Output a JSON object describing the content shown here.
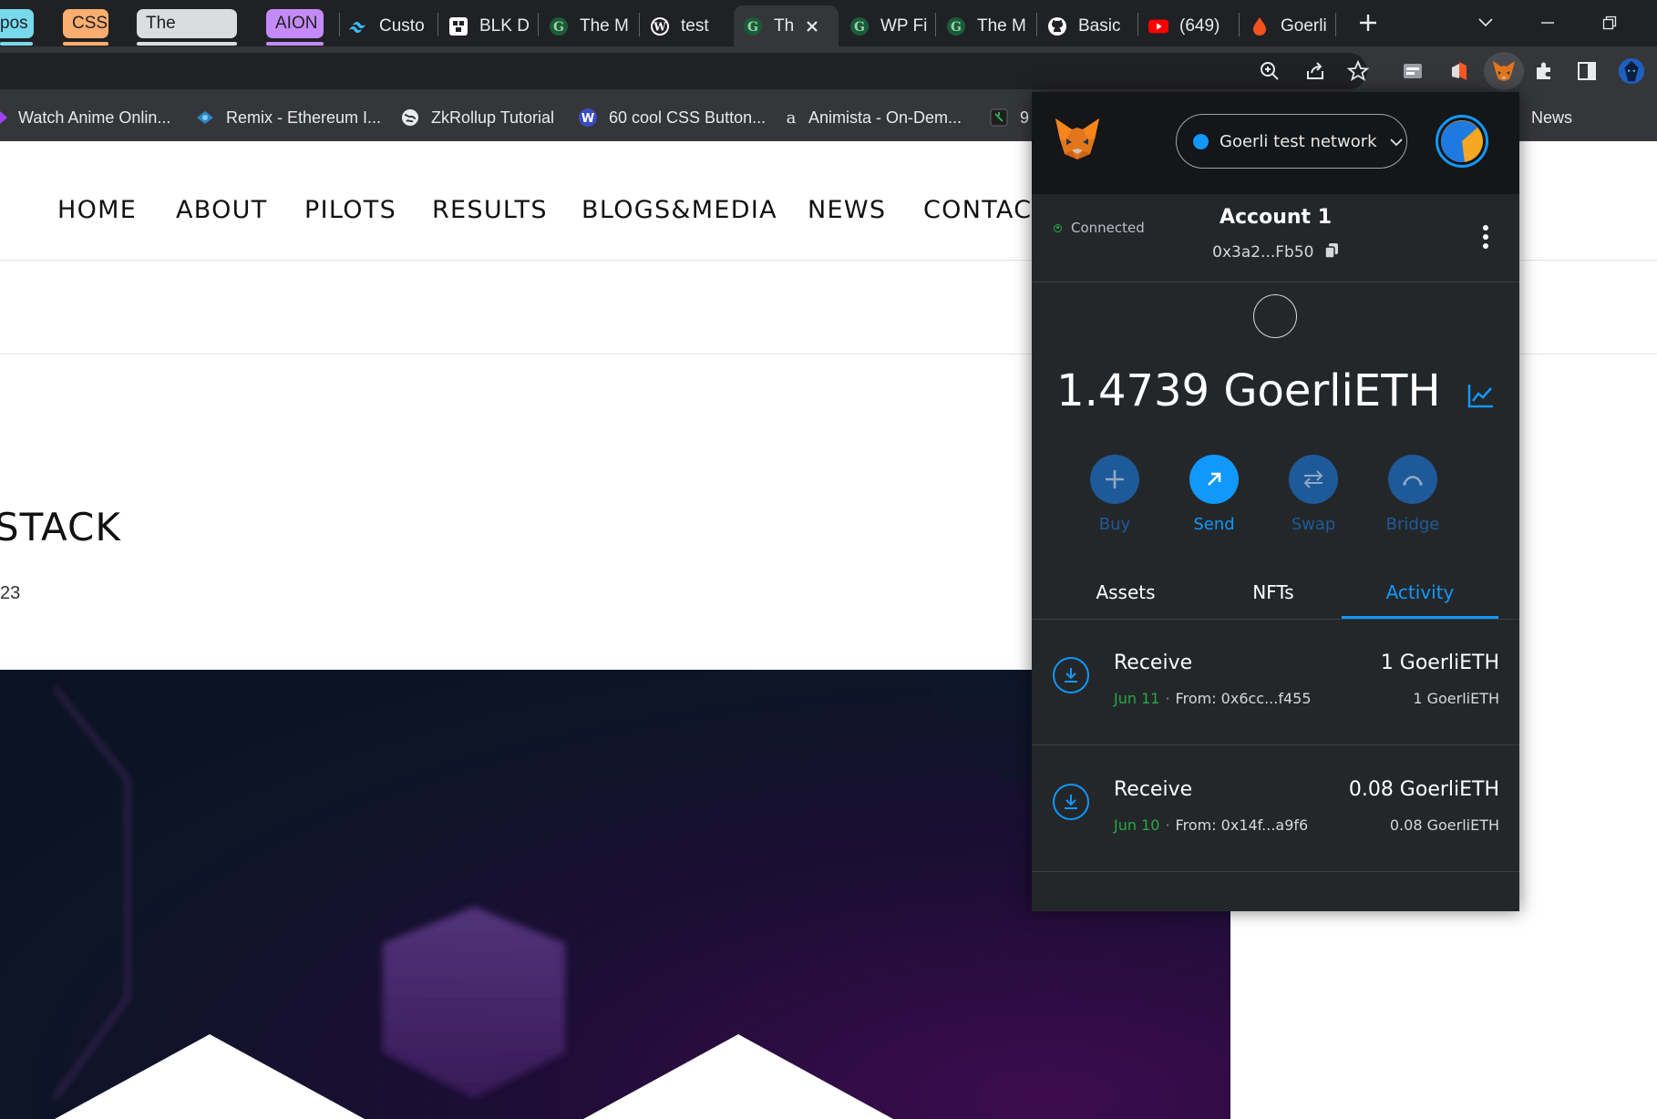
{
  "browser": {
    "tab_groups": [
      {
        "label": "pos",
        "bg": "#78d9ec",
        "color": "#202124"
      },
      {
        "label": "CSS",
        "bg": "#fcad70",
        "color": "#202124"
      },
      {
        "label": "The Others",
        "bg": "#dadce0",
        "color": "#202124"
      },
      {
        "label": "AION",
        "bg": "#c58af9",
        "color": "#202124"
      }
    ],
    "tabs": [
      {
        "title": "Custo",
        "icon": "tailwind-icon"
      },
      {
        "title": "BLK D",
        "icon": "blk-icon"
      },
      {
        "title": "The M",
        "icon": "g-logo-icon"
      },
      {
        "title": "test",
        "icon": "wordpress-icon"
      },
      {
        "title": "Th",
        "icon": "g-logo-icon",
        "active": true
      },
      {
        "title": "WP Fi",
        "icon": "g-logo-icon"
      },
      {
        "title": "The M",
        "icon": "g-logo-icon"
      },
      {
        "title": "Basic",
        "icon": "github-icon"
      },
      {
        "title": "(649)",
        "icon": "youtube-icon"
      },
      {
        "title": "Goerli",
        "icon": "faucet-drop-icon"
      }
    ],
    "bookmarks": [
      {
        "label": "Watch Anime Onlin..."
      },
      {
        "label": "Remix - Ethereum I..."
      },
      {
        "label": "ZkRollup Tutorial"
      },
      {
        "label": "60 cool CSS Button..."
      },
      {
        "label": "Animista - On-Dem..."
      },
      {
        "label": "9"
      },
      {
        "label": "News"
      }
    ]
  },
  "page": {
    "nav": [
      "HOME",
      "ABOUT",
      "PILOTS",
      "RESULTS",
      "BLOGS&MEDIA",
      "NEWS",
      "CONTACT"
    ],
    "post_title": "STACK",
    "post_date": "23"
  },
  "metamask": {
    "network": "Goerli test network",
    "status": "Connected",
    "account_name": "Account 1",
    "address": "0x3a2...Fb50",
    "balance": "1.4739 GoerliETH",
    "actions": [
      {
        "label": "Buy",
        "icon": "plus-icon",
        "enabled": false
      },
      {
        "label": "Send",
        "icon": "arrow-up-right-icon",
        "enabled": true
      },
      {
        "label": "Swap",
        "icon": "swap-arrows-icon",
        "enabled": false
      },
      {
        "label": "Bridge",
        "icon": "bridge-icon",
        "enabled": false
      }
    ],
    "tabs": [
      "Assets",
      "NFTs",
      "Activity"
    ],
    "active_tab": "Activity",
    "transactions": [
      {
        "kind": "Receive",
        "date": "Jun 11",
        "from": "From: 0x6cc...f455",
        "amount": "1 GoerliETH",
        "fiat": "1 GoerliETH"
      },
      {
        "kind": "Receive",
        "date": "Jun 10",
        "from": "From: 0x14f...a9f6",
        "amount": "0.08 GoerliETH",
        "fiat": "0.08 GoerliETH"
      }
    ],
    "colors": {
      "accent": "#1098fc",
      "connected": "#28a745",
      "bg": "#24272a"
    }
  }
}
